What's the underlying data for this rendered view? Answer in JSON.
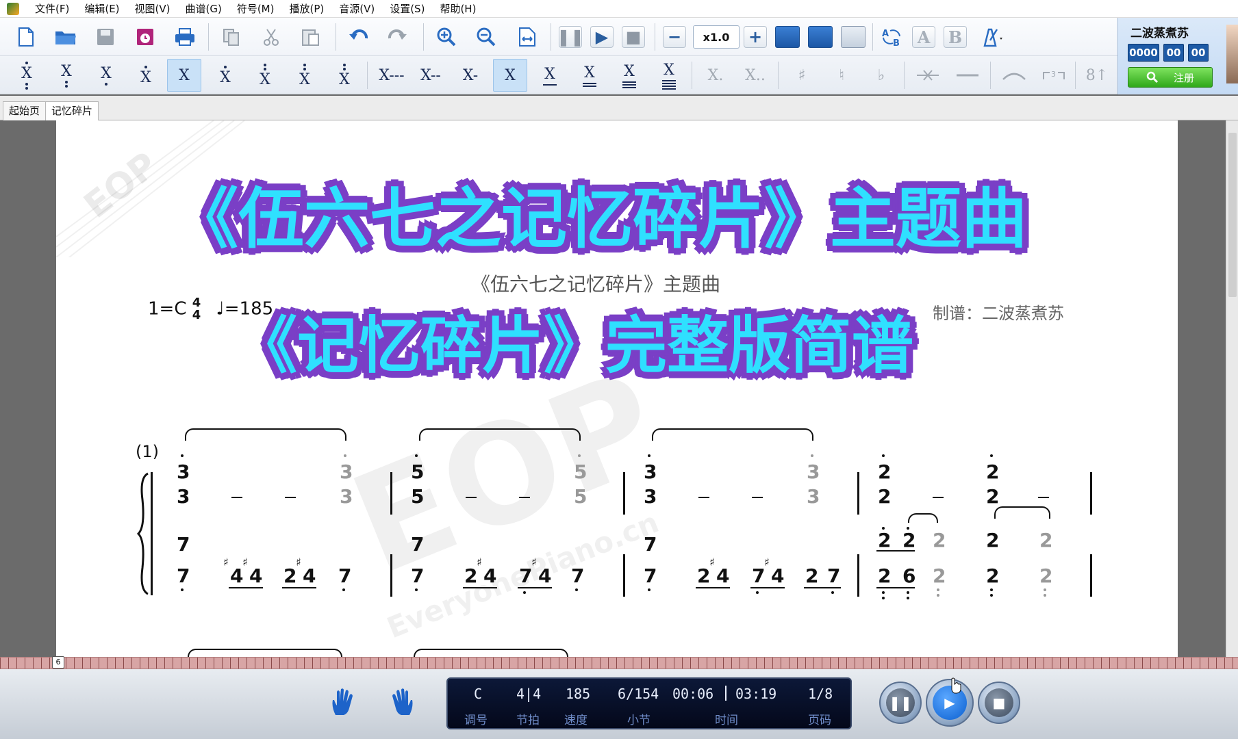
{
  "menu": [
    "文件(F)",
    "编辑(E)",
    "视图(V)",
    "曲谱(G)",
    "符号(M)",
    "播放(P)",
    "音源(V)",
    "设置(S)",
    "帮助(H)"
  ],
  "toolbar": {
    "speed": "x1.0",
    "note_buttons": [
      "X",
      "X",
      "X",
      "X",
      "X",
      "X",
      "X",
      "X",
      "X",
      "X---",
      "X--",
      "X-",
      "X",
      "X",
      "X",
      "X",
      "X",
      "X.",
      "X..",
      "♯",
      "♮",
      "♭",
      "8↑"
    ]
  },
  "user": {
    "name": "二波蒸煮苏",
    "counters": [
      "0000",
      "00",
      "00"
    ],
    "register_label": "注册"
  },
  "tabs": [
    "起始页",
    "记忆碎片"
  ],
  "overlay": {
    "line1": "《伍六七之记忆碎片》主题曲",
    "line2": "《记忆碎片》完整版简谱"
  },
  "watermark": {
    "logo": "EOP",
    "site": "EveryonePiano.cn"
  },
  "score": {
    "title": "《伍六七之记忆碎片》主题曲",
    "key": "1=C",
    "time_num": "4",
    "time_den": "4",
    "tempo": "♩=185",
    "composer": "制谱：二波蒸煮苏",
    "measure_label": "(1)"
  },
  "ruler": {
    "marker": "6"
  },
  "status": {
    "key": "C",
    "key_label": "调号",
    "beat": "4|4",
    "beat_label": "节拍",
    "speed": "185",
    "speed_label": "速度",
    "measure": "6/154",
    "measure_label": "小节",
    "time_current": "00:06",
    "time_total": "03:19",
    "time_label": "时间",
    "page": "1/8",
    "page_label": "页码"
  }
}
